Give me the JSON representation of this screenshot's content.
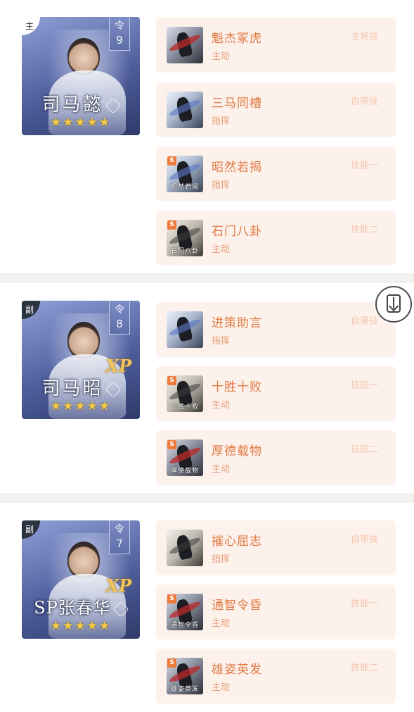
{
  "generals": [
    {
      "role": "主",
      "ling_label": "令",
      "ling_value": "9",
      "name": "司马懿",
      "stars": "★★★★★",
      "xp": "",
      "skills": [
        {
          "title": "魁杰冢虎",
          "type": "主动",
          "tag": "主将技",
          "badge": "",
          "caption": ""
        },
        {
          "title": "三马同槽",
          "type": "指挥",
          "tag": "自带技",
          "badge": "",
          "caption": ""
        },
        {
          "title": "昭然若揭",
          "type": "指挥",
          "tag": "技能一",
          "badge": "S",
          "caption": "昭然若揭"
        },
        {
          "title": "石门八卦",
          "type": "主动",
          "tag": "技能二",
          "badge": "S",
          "caption": "石门八卦"
        }
      ]
    },
    {
      "role": "副",
      "ling_label": "令",
      "ling_value": "8",
      "name": "司马昭",
      "stars": "★★★★★",
      "xp": "XP",
      "skills": [
        {
          "title": "进策助言",
          "type": "指挥",
          "tag": "自带技",
          "badge": "",
          "caption": ""
        },
        {
          "title": "十胜十败",
          "type": "主动",
          "tag": "技能一",
          "badge": "S",
          "caption": "十胜十败"
        },
        {
          "title": "厚德载物",
          "type": "主动",
          "tag": "技能二",
          "badge": "S",
          "caption": "厚德载物"
        }
      ]
    },
    {
      "role": "副",
      "ling_label": "令",
      "ling_value": "7",
      "name": "SP张春华",
      "stars": "★★★★★",
      "xp": "XP",
      "skills": [
        {
          "title": "摧心屈志",
          "type": "指挥",
          "tag": "自带技",
          "badge": "",
          "caption": ""
        },
        {
          "title": "通智令昏",
          "type": "主动",
          "tag": "技能一",
          "badge": "S",
          "caption": "通智令昏"
        },
        {
          "title": "雄姿英发",
          "type": "主动",
          "tag": "技能二",
          "badge": "S",
          "caption": "雄姿英发"
        }
      ]
    }
  ],
  "float_button": {
    "icon": "download-icon"
  }
}
